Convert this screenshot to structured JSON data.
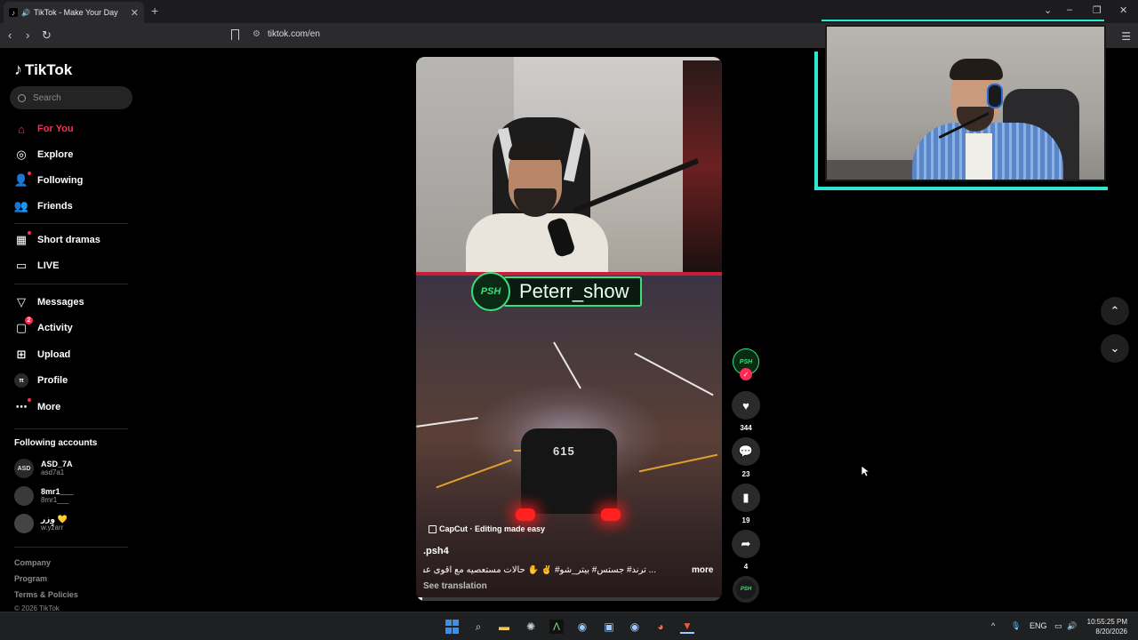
{
  "browser": {
    "tab_title": "TikTok - Make Your Day",
    "url": "tiktok.com/en"
  },
  "sidebar": {
    "logo_text": "TikTok",
    "search_placeholder": "Search",
    "nav": [
      {
        "label": "For You",
        "icon": "home-icon",
        "active": true
      },
      {
        "label": "Explore",
        "icon": "compass-icon"
      },
      {
        "label": "Following",
        "icon": "following-icon"
      },
      {
        "label": "Friends",
        "icon": "friends-icon"
      },
      {
        "label": "Short dramas",
        "icon": "short-dramas-icon"
      },
      {
        "label": "LIVE",
        "icon": "live-icon"
      },
      {
        "label": "Messages",
        "icon": "messages-icon"
      },
      {
        "label": "Activity",
        "icon": "activity-icon",
        "badge": "2"
      },
      {
        "label": "Upload",
        "icon": "upload-icon"
      },
      {
        "label": "Profile",
        "icon": "profile-icon"
      },
      {
        "label": "More",
        "icon": "more-icon"
      }
    ],
    "following_title": "Following accounts",
    "accounts": [
      {
        "name": "ASD_7A",
        "handle": "asd7a1",
        "avatar_text": "ASD"
      },
      {
        "name": "8mr1___",
        "handle": "8mr1___",
        "avatar_text": ""
      },
      {
        "name": "وٍزر 💛",
        "handle": "w.yzarr",
        "avatar_text": ""
      }
    ],
    "footer": [
      "Company",
      "Program",
      "Terms & Policies",
      "© 2026 TikTok"
    ]
  },
  "video": {
    "overlay_name": "Peterr_show",
    "overlay_emblem": "PSH",
    "plate_number": "615",
    "capcut_label": "CapCut · Editing made easy",
    "author": ".psh4",
    "caption": "... ترند# جستس# بيتر_شو# ✌️ ✋ حالات مستعصيه مع اقوى عسكري",
    "more_label": "more",
    "see_translation": "See translation",
    "progress": 0.02
  },
  "actions": {
    "avatar_text": "PSH",
    "likes": "344",
    "comments": "23",
    "saves": "19",
    "shares": "4"
  },
  "taskbar": {
    "lang": "ENG",
    "time": "10:55:25 PM",
    "date": "8/20/2026"
  },
  "colors": {
    "accent": "#fe2c55",
    "overlay_green": "#3be07a",
    "cam_frame": "#2be8d0"
  }
}
